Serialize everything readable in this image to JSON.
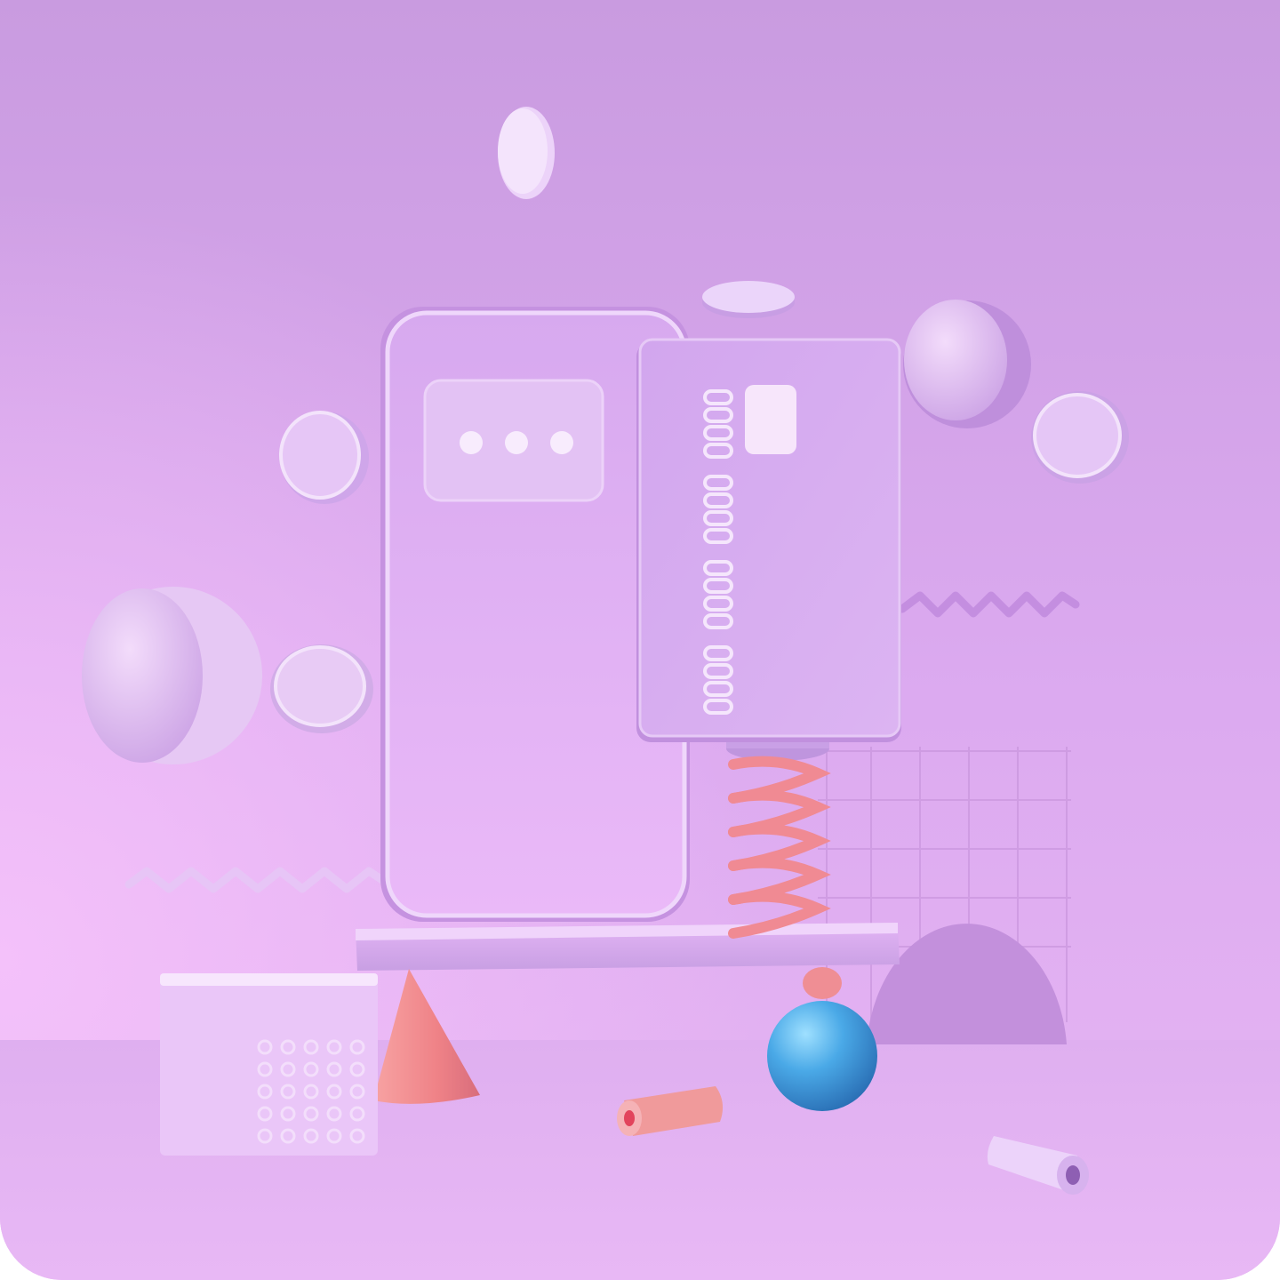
{
  "scene": {
    "colors": {
      "background_top": "#c99be0",
      "background_bottom": "#e7b6f3",
      "floor": "#e6b3f4",
      "phone": "#dcadf2",
      "card": "#d7aef0",
      "card_chip": "#f7e6fb",
      "spring": "#f08a93",
      "ball": "#49a8e6",
      "cone": "#f08c8e",
      "accent_white": "#f5e9fb"
    },
    "phone": {
      "message_dots": 3,
      "icon": "chat-bubble-icon"
    },
    "card": {
      "number_groups": 4,
      "digits_per_group": 4,
      "icon": "credit-card-icon"
    },
    "decorations": {
      "coins": 6,
      "hemispheres": 2,
      "zigzag_lines": 2,
      "grid": true,
      "cylinders": 2
    }
  }
}
